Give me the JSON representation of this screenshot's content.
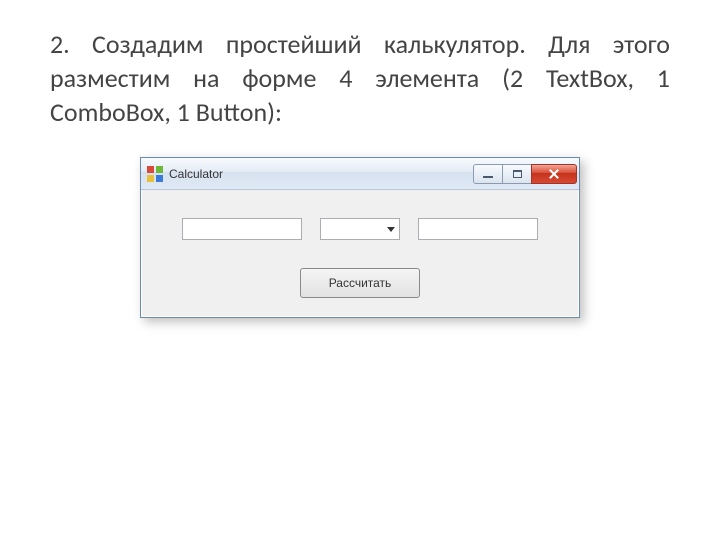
{
  "instruction": "2. Создадим простейший калькулятор. Для этого разместим на форме 4 элемента (2 TextBox, 1 ComboBox, 1 Button):",
  "window": {
    "title": "Calculator",
    "textbox1_value": "",
    "combobox_value": "",
    "textbox2_value": "",
    "button_label": "Рассчитать"
  }
}
